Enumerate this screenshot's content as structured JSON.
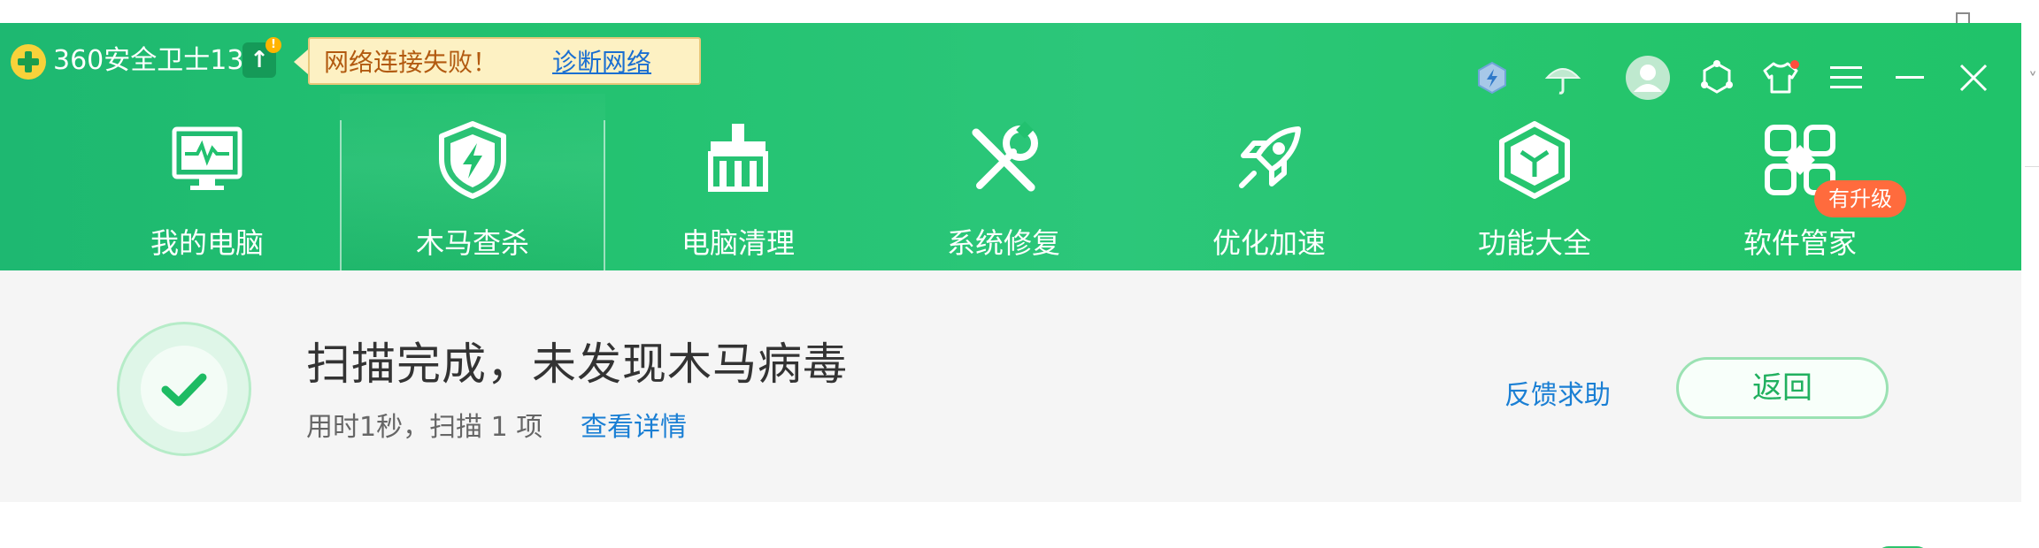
{
  "app": {
    "title": "360安全卫士13",
    "logo": "360-shield-logo",
    "upgrade_icon": "upload-arrow-icon",
    "upgrade_dot": "!"
  },
  "net_tip": {
    "message": "网络连接失败！",
    "link": "诊断网络"
  },
  "title_icons": [
    "speed-hexagon-icon",
    "umbrella-icon",
    "user-avatar-icon",
    "share-nodes-icon",
    "skin-shirt-icon",
    "menu-icon",
    "minimize-icon",
    "close-icon"
  ],
  "nav": {
    "items": [
      {
        "label": "我的电脑",
        "icon": "monitor-pulse-icon",
        "active": false
      },
      {
        "label": "木马查杀",
        "icon": "shield-bolt-icon",
        "active": true
      },
      {
        "label": "电脑清理",
        "icon": "broom-icon",
        "active": false
      },
      {
        "label": "系统修复",
        "icon": "wrench-screwdriver-icon",
        "active": false
      },
      {
        "label": "优化加速",
        "icon": "rocket-icon",
        "active": false
      },
      {
        "label": "功能大全",
        "icon": "cube-hexagon-icon",
        "active": false
      },
      {
        "label": "软件管家",
        "icon": "four-leaf-icon",
        "active": false,
        "badge": "有升级"
      }
    ]
  },
  "result": {
    "title": "扫描完成，未发现木马病毒",
    "subtitle": "用时1秒，扫描 1 项",
    "details_link": "查看详情",
    "feedback": "反馈求助",
    "back_button": "返回"
  },
  "colors": {
    "header_green": "#22c16f",
    "link_blue": "#1a7fd4",
    "badge_orange": "#ff6b3d",
    "tip_bg": "#fdf1c3"
  }
}
